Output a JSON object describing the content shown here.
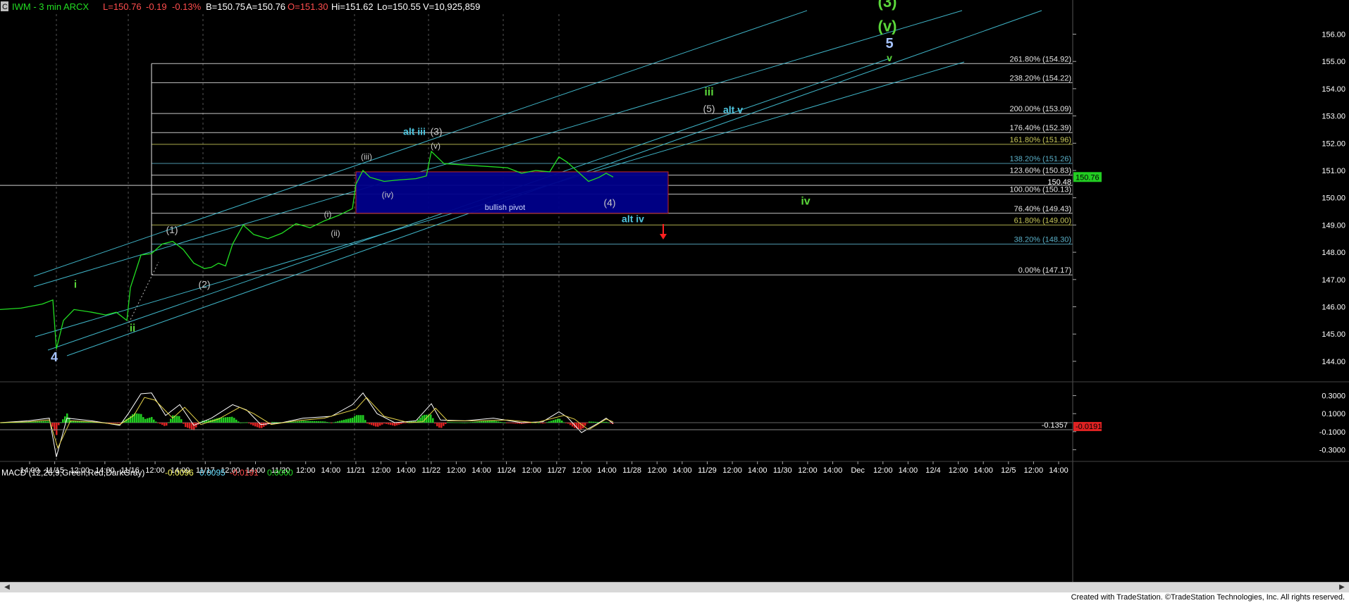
{
  "header": {
    "symbol_icon": "C",
    "title": "IWM - 3 min  ARCX",
    "last": "L=150.76",
    "change": "-0.19",
    "pct": "-0.13%",
    "bid": "B=150.75",
    "ask": "A=150.76",
    "open": "O=151.30",
    "high": "Hi=151.62",
    "low": "Lo=150.55",
    "volume": "V=10,925,859"
  },
  "macd_header": {
    "label": "MACD (12,26,9,Green,Red,DarkGray)",
    "v1": "-0.0096",
    "v2": "0.0095",
    "v3": "-0.0191",
    "v4": "0.0000"
  },
  "footer": {
    "credit": "Created with TradeStation. ©TradeStation Technologies, Inc. All rights reserved."
  },
  "colors": {
    "price": "#22dd22",
    "channel": "#3fb3c6",
    "pivot_fill": "#00008b",
    "pivot_border": "#d22c2c",
    "label_white": "#c8c8c8",
    "label_green": "#5ad63a",
    "label_cyan": "#4ec6e0",
    "label_blue": "#a7c4ff",
    "macd_up": "#22cc22",
    "macd_down": "#dd2222"
  },
  "chart_data": [
    {
      "type": "line",
      "ylim": [
        143.5,
        156.6
      ],
      "y_ticks": [
        "156.00",
        "155.00",
        "154.00",
        "153.00",
        "152.00",
        "151.00",
        "150.00",
        "149.00",
        "148.00",
        "147.00",
        "146.00",
        "145.00",
        "144.00"
      ],
      "x_ticks": [
        "14:00",
        "11/15",
        "12:00",
        "14:00",
        "11/16",
        "12:00",
        "14:00",
        "11/17",
        "12:00",
        "14:00",
        "11/20",
        "12:00",
        "14:00",
        "11/21",
        "12:00",
        "14:00",
        "11/22",
        "12:00",
        "14:00",
        "11/24",
        "12:00",
        "11/27",
        "12:00",
        "14:00",
        "11/28",
        "12:00",
        "14:00",
        "11/29",
        "12:00",
        "14:00",
        "11/30",
        "12:00",
        "14:00",
        "Dec",
        "12:00",
        "14:00",
        "12/4",
        "12:00",
        "14:00",
        "12/5",
        "12:00",
        "14:00"
      ],
      "last_price": "150.76",
      "last_close_label": "150.48",
      "price_series": [
        [
          0,
          145.9
        ],
        [
          30,
          145.95
        ],
        [
          60,
          146.1
        ],
        [
          75,
          146.25
        ],
        [
          80,
          144.45
        ],
        [
          90,
          145.5
        ],
        [
          105,
          145.9
        ],
        [
          130,
          145.8
        ],
        [
          150,
          145.7
        ],
        [
          165,
          145.8
        ],
        [
          180,
          145.5
        ],
        [
          185,
          146.7
        ],
        [
          200,
          147.9
        ],
        [
          215,
          147.95
        ],
        [
          230,
          148.3
        ],
        [
          245,
          148.4
        ],
        [
          260,
          148.1
        ],
        [
          275,
          147.6
        ],
        [
          290,
          147.4
        ],
        [
          300,
          147.45
        ],
        [
          310,
          147.6
        ],
        [
          320,
          147.5
        ],
        [
          330,
          148.3
        ],
        [
          345,
          149.0
        ],
        [
          360,
          148.65
        ],
        [
          380,
          148.5
        ],
        [
          400,
          148.7
        ],
        [
          420,
          149.05
        ],
        [
          440,
          148.9
        ],
        [
          460,
          149.15
        ],
        [
          480,
          149.35
        ],
        [
          500,
          149.6
        ],
        [
          505,
          150.5
        ],
        [
          515,
          151.0
        ],
        [
          525,
          150.75
        ],
        [
          545,
          150.6
        ],
        [
          565,
          150.65
        ],
        [
          590,
          150.7
        ],
        [
          605,
          150.8
        ],
        [
          612,
          151.7
        ],
        [
          620,
          151.5
        ],
        [
          630,
          151.25
        ],
        [
          660,
          151.2
        ],
        [
          690,
          151.15
        ],
        [
          720,
          151.1
        ],
        [
          740,
          150.9
        ],
        [
          760,
          151.0
        ],
        [
          780,
          150.95
        ],
        [
          793,
          151.5
        ],
        [
          805,
          151.3
        ],
        [
          820,
          150.95
        ],
        [
          835,
          150.6
        ],
        [
          850,
          150.75
        ],
        [
          860,
          150.9
        ],
        [
          870,
          150.76
        ]
      ],
      "fib_levels": [
        {
          "label": "261.80% (154.92)",
          "value": 154.92
        },
        {
          "label": "238.20% (154.22)",
          "value": 154.22
        },
        {
          "label": "200.00% (153.09)",
          "value": 153.09
        },
        {
          "label": "176.40% (152.39)",
          "value": 152.39
        },
        {
          "label": "161.80% (151.96)",
          "value": 151.96
        },
        {
          "label": "138.20% (151.26)",
          "value": 151.26
        },
        {
          "label": "123.60% (150.83)",
          "value": 150.83
        },
        {
          "label": "100.00% (150.13)",
          "value": 150.13
        },
        {
          "label": "76.40% (149.43)",
          "value": 149.43
        },
        {
          "label": "61.80% (149.00)",
          "value": 149.0
        },
        {
          "label": "38.20% (148.30)",
          "value": 148.3
        },
        {
          "label": "0.00% (147.17)",
          "value": 147.17
        }
      ],
      "pivot_box": {
        "label": "bullish pivot",
        "x0": 505,
        "x1": 948,
        "y_low": 149.43,
        "y_high": 150.95
      },
      "annotations": [
        {
          "text": "4",
          "x": 77,
          "y": 144.0,
          "color": "blue",
          "size": 18
        },
        {
          "text": "i",
          "x": 107,
          "y": 146.7,
          "color": "green",
          "size": 15
        },
        {
          "text": "ii",
          "x": 188,
          "y": 145.1,
          "color": "green",
          "size": 15
        },
        {
          "text": "(1)",
          "x": 244,
          "y": 148.7,
          "color": "white",
          "size": 14
        },
        {
          "text": "(2)",
          "x": 290,
          "y": 146.7,
          "color": "white",
          "size": 14
        },
        {
          "text": "(i)",
          "x": 465,
          "y": 149.3,
          "color": "white",
          "size": 12
        },
        {
          "text": "(ii)",
          "x": 476,
          "y": 148.6,
          "color": "white",
          "size": 12
        },
        {
          "text": "(iii)",
          "x": 520,
          "y": 151.4,
          "color": "white",
          "size": 12
        },
        {
          "text": "(iv)",
          "x": 550,
          "y": 150.0,
          "color": "white",
          "size": 12
        },
        {
          "text": "(v)",
          "x": 618,
          "y": 151.8,
          "color": "white",
          "size": 12
        },
        {
          "text": "alt iii",
          "x": 588,
          "y": 152.3,
          "color": "cyan",
          "size": 14
        },
        {
          "text": "(3)",
          "x": 619,
          "y": 152.3,
          "color": "white",
          "size": 14
        },
        {
          "text": "(4)",
          "x": 865,
          "y": 149.7,
          "color": "white",
          "size": 14
        },
        {
          "text": "alt iv",
          "x": 898,
          "y": 149.1,
          "color": "cyan",
          "size": 14
        },
        {
          "text": "iii",
          "x": 1006,
          "y": 153.75,
          "color": "green",
          "size": 16
        },
        {
          "text": "(5)",
          "x": 1006,
          "y": 153.15,
          "color": "white",
          "size": 14
        },
        {
          "text": "alt v",
          "x": 1040,
          "y": 153.1,
          "color": "cyan",
          "size": 14
        },
        {
          "text": "iv",
          "x": 1143,
          "y": 149.75,
          "color": "green",
          "size": 16
        },
        {
          "text": "(3)",
          "x": 1259,
          "y": 157.0,
          "color": "green",
          "size": 22
        },
        {
          "text": "(v)",
          "x": 1259,
          "y": 156.1,
          "color": "green",
          "size": 22
        },
        {
          "text": "5",
          "x": 1262,
          "y": 155.5,
          "color": "blue",
          "size": 20
        },
        {
          "text": "v",
          "x": 1262,
          "y": 155.0,
          "color": "green",
          "size": 14
        }
      ]
    },
    {
      "type": "area",
      "name": "MACD",
      "ylim": [
        -0.45,
        0.45
      ],
      "y_ticks": [
        "0.3000",
        "0.1000",
        "-0.1000",
        "-0.3000"
      ],
      "value_labels": [
        "-0.1357",
        "-0.0191"
      ],
      "macd_line": [
        [
          0,
          0.0
        ],
        [
          40,
          0.02
        ],
        [
          70,
          0.05
        ],
        [
          80,
          -0.38
        ],
        [
          95,
          0.05
        ],
        [
          130,
          0.02
        ],
        [
          170,
          -0.03
        ],
        [
          182,
          0.1
        ],
        [
          200,
          0.32
        ],
        [
          215,
          0.33
        ],
        [
          235,
          0.08
        ],
        [
          255,
          0.2
        ],
        [
          275,
          -0.03
        ],
        [
          300,
          0.05
        ],
        [
          330,
          0.2
        ],
        [
          350,
          0.14
        ],
        [
          370,
          -0.02
        ],
        [
          400,
          0.0
        ],
        [
          430,
          0.05
        ],
        [
          470,
          0.07
        ],
        [
          500,
          0.2
        ],
        [
          515,
          0.33
        ],
        [
          535,
          0.1
        ],
        [
          560,
          0.0
        ],
        [
          590,
          0.02
        ],
        [
          612,
          0.21
        ],
        [
          625,
          0.03
        ],
        [
          660,
          0.02
        ],
        [
          700,
          0.05
        ],
        [
          740,
          0.0
        ],
        [
          770,
          0.01
        ],
        [
          793,
          0.12
        ],
        [
          805,
          0.06
        ],
        [
          825,
          -0.11
        ],
        [
          850,
          0.0
        ],
        [
          860,
          0.05
        ],
        [
          870,
          -0.0096
        ]
      ],
      "signal_line": [
        [
          0,
          0.0
        ],
        [
          40,
          0.01
        ],
        [
          70,
          0.03
        ],
        [
          82,
          -0.28
        ],
        [
          100,
          0.02
        ],
        [
          130,
          0.01
        ],
        [
          170,
          -0.02
        ],
        [
          190,
          0.08
        ],
        [
          205,
          0.28
        ],
        [
          220,
          0.25
        ],
        [
          245,
          0.05
        ],
        [
          262,
          0.17
        ],
        [
          285,
          -0.02
        ],
        [
          310,
          0.04
        ],
        [
          340,
          0.17
        ],
        [
          360,
          0.1
        ],
        [
          385,
          -0.02
        ],
        [
          420,
          0.02
        ],
        [
          460,
          0.05
        ],
        [
          505,
          0.15
        ],
        [
          520,
          0.28
        ],
        [
          545,
          0.07
        ],
        [
          580,
          0.0
        ],
        [
          600,
          0.01
        ],
        [
          618,
          0.16
        ],
        [
          635,
          0.02
        ],
        [
          680,
          0.02
        ],
        [
          720,
          0.03
        ],
        [
          760,
          0.0
        ],
        [
          800,
          0.08
        ],
        [
          815,
          0.04
        ],
        [
          835,
          -0.08
        ],
        [
          860,
          0.04
        ],
        [
          870,
          0.0095
        ]
      ]
    }
  ]
}
